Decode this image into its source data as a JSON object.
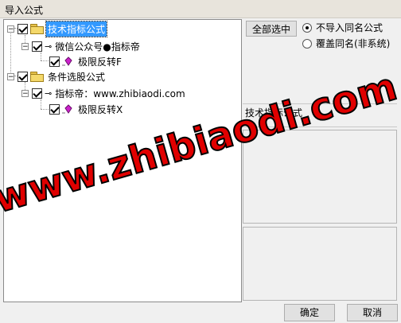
{
  "window": {
    "title": "导入公式"
  },
  "tree": {
    "nodes": [
      {
        "label": "技术指标公式"
      },
      {
        "label": "微信公众号●指标帝"
      },
      {
        "label": "极限反转F"
      },
      {
        "label": "条件选股公式"
      },
      {
        "label": "指标帝：www.zhibiaodi.com"
      },
      {
        "label": "极限反转X"
      }
    ]
  },
  "options": {
    "select_all_label": "全部选中",
    "radio_no_import_label": "不导入同名公式",
    "radio_overwrite_label": "覆盖同名(非系统)"
  },
  "info": {
    "formula_type": "技术指标公式"
  },
  "footer": {
    "ok_label": "确定",
    "cancel_label": "取消"
  },
  "watermark": {
    "text": "www.zhibiaodi.com"
  },
  "colors": {
    "selection": "#3399ff",
    "watermark": "#e00000",
    "gem": "#cc22cc"
  }
}
